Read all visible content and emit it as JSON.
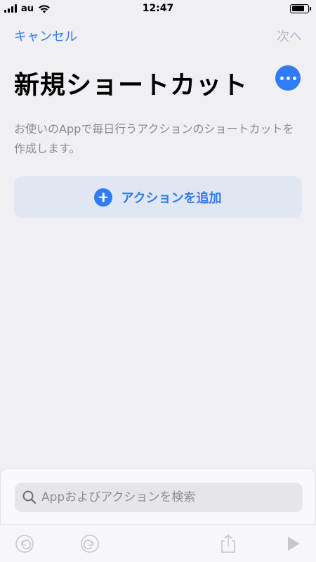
{
  "status_bar": {
    "carrier": "au",
    "time": "12:47",
    "battery_level_percent": 80
  },
  "nav": {
    "cancel_label": "キャンセル",
    "next_label": "次へ"
  },
  "page": {
    "title": "新規ショートカット",
    "description": "お使いのAppで毎日行うアクションのショートカットを作成します。"
  },
  "add_action": {
    "label": "アクションを追加"
  },
  "search": {
    "placeholder": "Appおよびアクションを検索",
    "value": ""
  },
  "toolbar": {
    "icons": [
      "undo-icon",
      "redo-icon",
      "share-icon",
      "play-icon"
    ]
  },
  "colors": {
    "accent": "#2F7CF6",
    "background": "#EFEFF4",
    "disabled": "#B8B8BE",
    "add_action_bg": "#E1E6F3"
  }
}
